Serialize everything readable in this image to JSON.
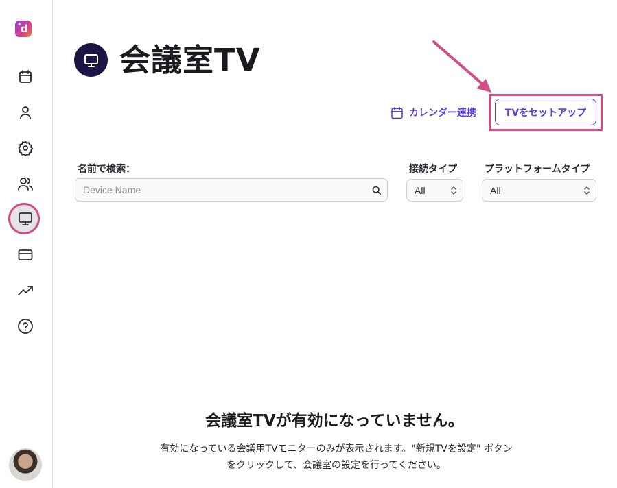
{
  "app": {
    "logo_letter": "d"
  },
  "sidebar": {
    "items": [
      {
        "name": "calendar",
        "icon": "calendar-icon"
      },
      {
        "name": "user",
        "icon": "user-icon"
      },
      {
        "name": "settings",
        "icon": "gear-icon"
      },
      {
        "name": "users",
        "icon": "users-icon"
      },
      {
        "name": "room-tv",
        "icon": "monitor-icon",
        "active": true
      },
      {
        "name": "billing",
        "icon": "credit-card-icon"
      },
      {
        "name": "analytics",
        "icon": "trending-up-icon"
      },
      {
        "name": "help",
        "icon": "help-circle-icon"
      }
    ],
    "avatar": "avatar"
  },
  "header": {
    "title": "会議室TV",
    "icon": "monitor-icon"
  },
  "actions": {
    "calendar_link": "カレンダー連携",
    "setup_button": "TVをセットアップ"
  },
  "filters": {
    "search_label": "名前で検索：",
    "search_placeholder": "Device Name",
    "search_value": "",
    "connection_label": "接続タイプ",
    "connection_value": "All",
    "platform_label": "プラットフォームタイプ",
    "platform_value": "All"
  },
  "empty_state": {
    "title": "会議室TVが有効になっていません。",
    "line1": "有効になっている会議用TVモニターのみが表示されます。\"新規TVを設定\" ボタン",
    "line2": "をクリックして、会議室の設定を行ってください。"
  },
  "colors": {
    "accent": "#5b3fd8",
    "highlight": "#d14d86",
    "header_icon_bg": "#1d1446"
  }
}
